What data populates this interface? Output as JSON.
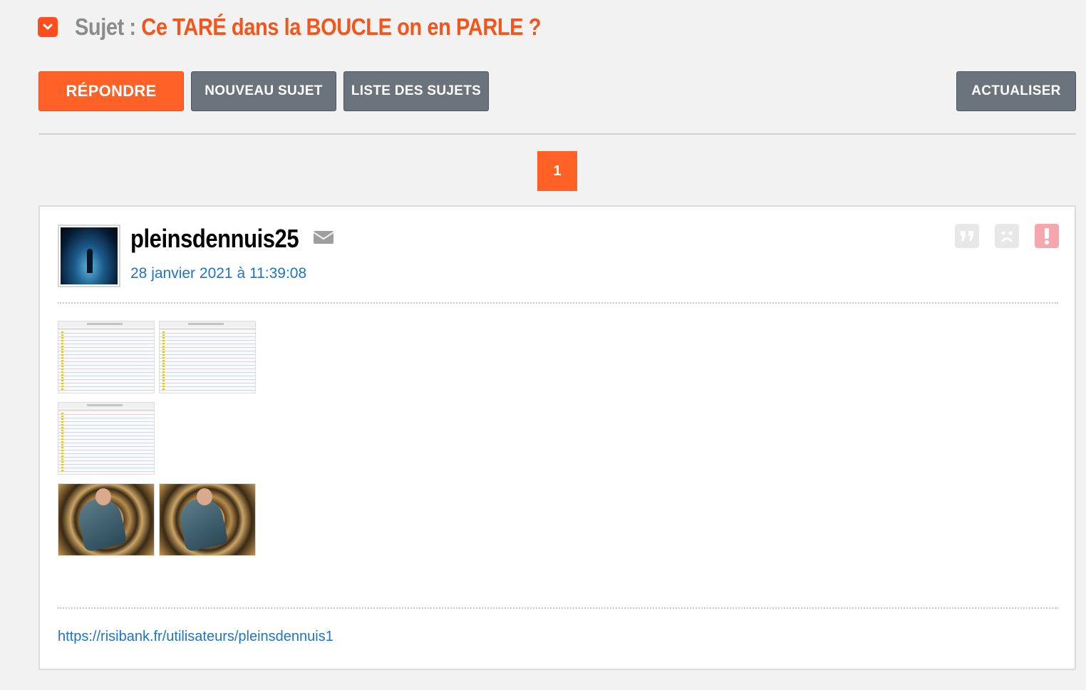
{
  "topic": {
    "label": "Sujet :",
    "title": "Ce TARÉ dans la BOUCLE on en PARLE ?"
  },
  "toolbar": {
    "reply_label": "RÉPONDRE",
    "new_topic_label": "NOUVEAU SUJET",
    "topic_list_label": "LISTE DES SUJETS",
    "refresh_label": "ACTUALISER"
  },
  "pagination": {
    "current_page": "1"
  },
  "post": {
    "author": "pleinsdennuis25",
    "date": "28 janvier 2021 à 11:39:08",
    "images": [
      {
        "kind": "screenshot"
      },
      {
        "kind": "screenshot"
      },
      {
        "kind": "screenshot"
      },
      {
        "kind": "photo"
      },
      {
        "kind": "photo"
      }
    ],
    "signature_link": "https://risibank.fr/utilisateurs/pleinsdennuis1"
  },
  "icons": {
    "collapse": "chevron-down-icon",
    "mail": "envelope-icon",
    "quote": "quote-icon",
    "sad": "sad-face-icon",
    "alert": "alert-icon"
  },
  "colors": {
    "accent": "#ff6127",
    "title": "#f2561d",
    "grey_button": "#6b747d",
    "link": "#1f74c4"
  }
}
